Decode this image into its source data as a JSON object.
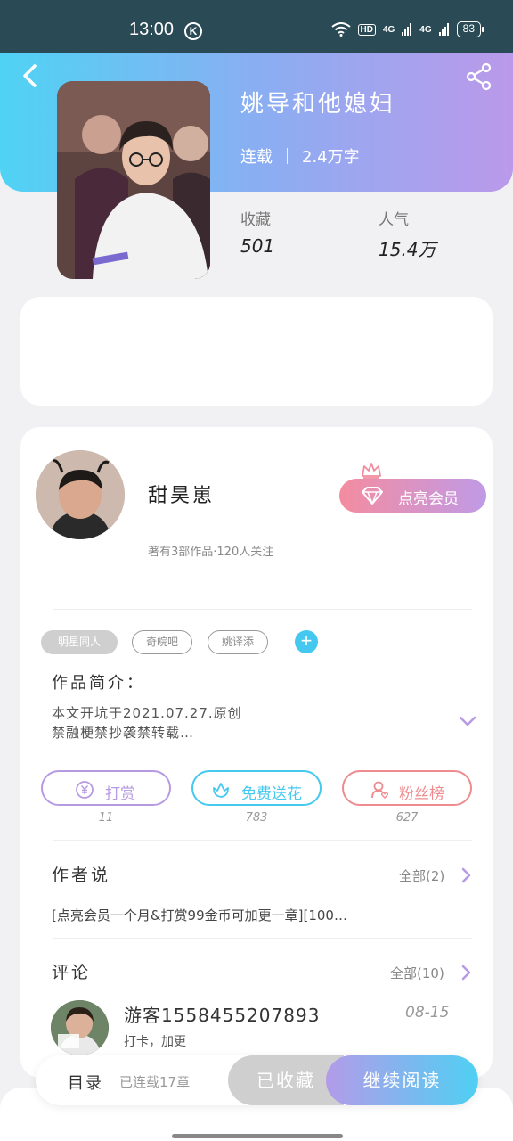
{
  "status_bar": {
    "time": "13:00",
    "k_badge": "K",
    "hd": "HD",
    "net1": "4G",
    "net2": "4G",
    "battery": "83"
  },
  "book": {
    "title": "姚导和他媳妇",
    "status": "连载",
    "word_count": "2.4万字",
    "favorites_label": "收藏",
    "favorites_value": "501",
    "popularity_label": "人气",
    "popularity_value": "15.4万"
  },
  "author": {
    "name": "甜昊崽",
    "subtitle": "著有3部作品·120人关注",
    "vip_button": "点亮会员"
  },
  "tags": [
    "明星同人",
    "奇皖吧",
    "姚译添"
  ],
  "tag_add": "+",
  "intro": {
    "title": "作品简介：",
    "line1": "本文开坑于2021.07.27.原创",
    "line2": "禁融梗禁抄袭禁转载…"
  },
  "actions": [
    {
      "label": "打赏",
      "count": "11",
      "color": "#b89ae3"
    },
    {
      "label": "免费送花",
      "count": "783",
      "color": "#45c9ef"
    },
    {
      "label": "粉丝榜",
      "count": "627",
      "color": "#ef8b8e"
    }
  ],
  "author_says": {
    "title": "作者说",
    "all": "全部(2)",
    "text": "[点亮会员一个月&打赏99金币可加更一章][100…"
  },
  "comments": {
    "title": "评论",
    "all": "全部(10)",
    "items": [
      {
        "user": "游客15584552078​93",
        "date": "08-15",
        "text": "打卡，加更"
      }
    ]
  },
  "bottom_bar": {
    "toc": "目录",
    "toc_sub": "已连载17章",
    "favorited": "已收藏",
    "continue": "继续阅读"
  },
  "icons": {
    "back": "back-arrow-icon",
    "share": "share-icon",
    "vip_gem": "diamond-icon",
    "crown": "crown-icon",
    "expand": "chevron-down-icon",
    "tip": "coin-icon",
    "flower": "flower-icon",
    "fans": "person-heart-icon"
  },
  "colors": {
    "accent_cyan": "#4fd3f4",
    "accent_purple": "#bb99ea",
    "vip_pink": "#f48ca0"
  }
}
